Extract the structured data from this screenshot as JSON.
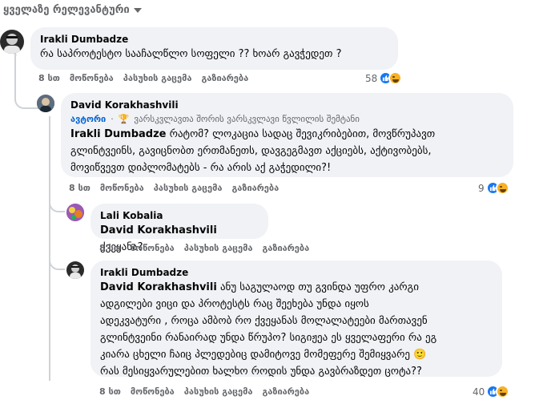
{
  "sort": {
    "label": "ყველაზე რელევანტური"
  },
  "colors": {
    "like_blue": "#1877f2",
    "haha_yellow": "#f7b125",
    "bubble_bg": "#f0f2f5",
    "author_link": "#0064d1"
  },
  "comments": [
    {
      "author": "Irakli Dumbadze",
      "text": "რა საპროტესტო სააჩალწლო სოფელი ?? ხოარ გავჭედეთ ?",
      "time": "8 სთ",
      "like": "მოწონება",
      "reply": "პასუხის გაცემა",
      "share": "გაზიარება",
      "reaction_count": "58",
      "reaction_icons": [
        "like-icon",
        "haha-icon"
      ]
    },
    {
      "author": "David Korakhashvili",
      "badge_author": "ავტორი",
      "badge_text": "ვარსკვლავთა შორის ვარსკვლავი წვლილის შემტანი",
      "mention": "Irakli Dumbadze",
      "lines": [
        "რატომ? ლოკაცია სადაც შევიკრიბებით, მოვწრუპავთ",
        "გლინტვეინს, გავიცნობთ ერთმანეთს, დავგეგმავთ აქციებს, აქტივობებს,",
        "მოვიწვევთ დიპლომატებს - რა არის აქ გაჭედილი?!"
      ],
      "time": "8 სთ",
      "like": "მოწონება",
      "reply": "პასუხის გაცემა",
      "share": "გაზიარება",
      "reaction_count": "9",
      "reaction_icons": [
        "like-icon",
        "haha-icon"
      ]
    },
    {
      "author": "Lali Kobalia",
      "mention": "David Korakhashvili",
      "text": "ქვეყანა?",
      "time": "8 სთ",
      "like": "მოწონება",
      "reply": "პასუხის გაცემა",
      "share": "გაზიარება"
    },
    {
      "author": "Irakli Dumbadze",
      "mention": "David Korakhashvili",
      "lines": [
        "ანუ საგულაოდ თუ გვინდა უფრო კარგი",
        "ადგილები ვიცი და პროტესტს რაც შეეხება უნდა იყოს",
        "ადეკვატური , როცა ამბობ რო ქვეყანას მოლალატეები მართავენ",
        "გლინტვეინი რანაირად უნდა წრუპო? სიგიჟეა ეს ყველაფერი რა ეგ",
        "კიარა ცხელი ჩაიც პლედებიც დამიტოვე მომეფერე შემიყვარე 🙂",
        "რას მესიყვარულებით ხალხო როდის უნდა გავბრაზდეთ ცოტა??"
      ],
      "time": "8 სთ",
      "like": "მოწონება",
      "reply": "პასუხის გაცემა",
      "share": "გაზიარება",
      "reaction_count": "40",
      "reaction_icons": [
        "like-icon",
        "haha-icon"
      ]
    }
  ]
}
